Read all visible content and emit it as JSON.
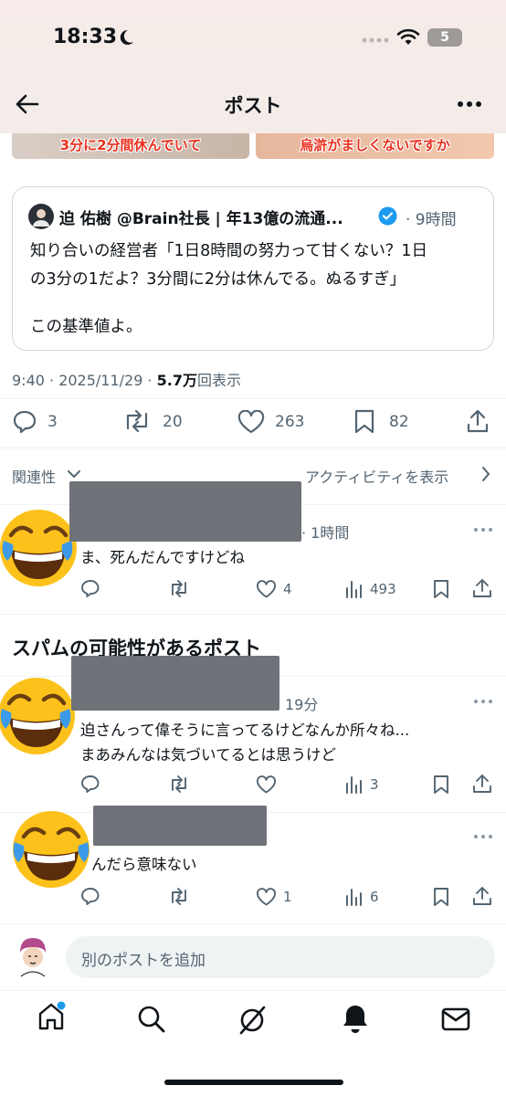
{
  "status": {
    "time": "18:33",
    "battery": "5"
  },
  "header": {
    "title": "ポスト"
  },
  "thumbnails": [
    {
      "caption": "3分に2分間休んでいて"
    },
    {
      "caption": "烏滸がましくないですか"
    }
  ],
  "quote": {
    "author": "迫 佑樹 @Brain社長 | 年13億の流通...",
    "time": "· 9時間",
    "lines": [
      "知り合いの経営者「1日8時間の努力って甘くない？1日",
      "の3分の1だよ？3分間に2分は休んでる。ぬるすぎ」",
      "この基準値よ。"
    ]
  },
  "post_meta": {
    "date": "9:40 · 2025/11/29 · ",
    "views_num": "5.7万",
    "views_label": "回表示"
  },
  "actions": {
    "replies": "3",
    "reposts": "20",
    "likes": "263",
    "bookmarks": "82"
  },
  "sort": {
    "label": "関連性",
    "activity": "アクティビティを表示"
  },
  "replies": [
    {
      "time": "· 1時間",
      "text": [
        "ま、死んだんですけどね"
      ],
      "likes": "4",
      "views": "493"
    },
    {
      "time": "19分",
      "text": [
        "迫さんって偉そうに言ってるけどなんか所々ね...",
        "まあみんなは気づいてるとは思うけど"
      ],
      "likes": "",
      "views": "3"
    },
    {
      "time": "",
      "text": [
        "んだら意味ない"
      ],
      "likes": "1",
      "views": "6"
    }
  ],
  "spam_heading": "スパムの可能性があるポスト",
  "composer": {
    "placeholder": "別のポストを追加"
  },
  "colors": {
    "accent": "#1d9bf0",
    "text": "#0f1419",
    "muted": "#536471"
  },
  "icons": [
    "back-arrow-icon",
    "more-icon",
    "verified-icon",
    "reply-icon",
    "repost-icon",
    "like-icon",
    "bookmark-icon",
    "share-icon",
    "views-icon",
    "home-icon",
    "search-icon",
    "grok-icon",
    "bell-icon",
    "mail-icon",
    "laughing-emoji-icon"
  ]
}
